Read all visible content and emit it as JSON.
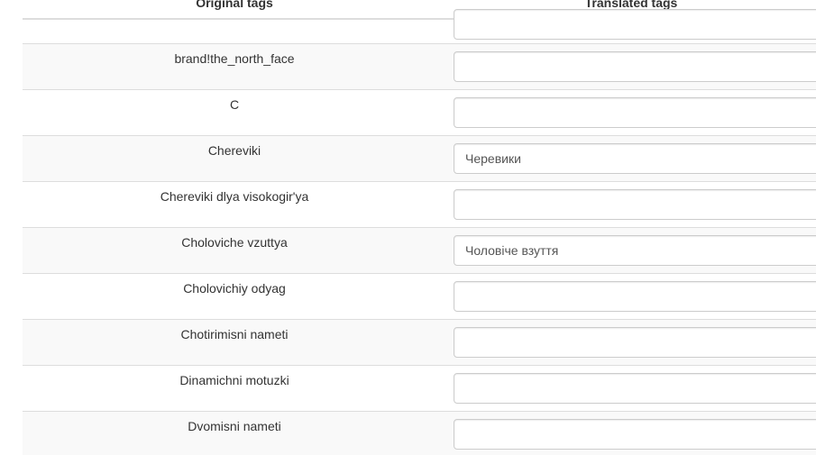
{
  "table": {
    "headers": {
      "original": "Original tags",
      "translated": "Translated tags"
    },
    "rows": [
      {
        "original": "",
        "translated": ""
      },
      {
        "original": "brand!the_north_face",
        "translated": ""
      },
      {
        "original": "C",
        "translated": ""
      },
      {
        "original": "Chereviki",
        "translated": "Черевики"
      },
      {
        "original": "Chereviki dlya visokogir'ya",
        "translated": ""
      },
      {
        "original": "Choloviche vzuttya",
        "translated": "Чоловіче взуття"
      },
      {
        "original": "Cholovichiy odyag",
        "translated": ""
      },
      {
        "original": "Chotirimisni nameti",
        "translated": ""
      },
      {
        "original": "Dinamichni motuzki",
        "translated": ""
      },
      {
        "original": "Dvomisni nameti",
        "translated": ""
      }
    ]
  }
}
